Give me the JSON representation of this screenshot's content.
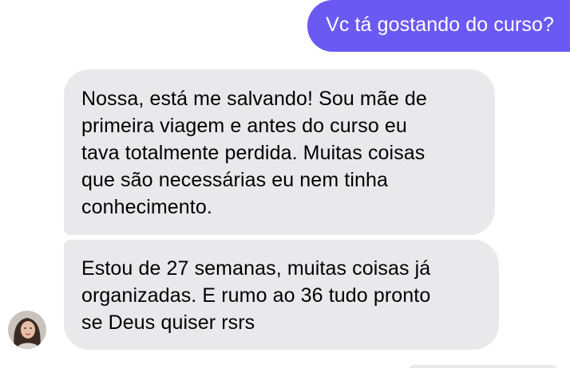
{
  "messages": {
    "sent": {
      "text": "Vc tá gostando do curso?"
    },
    "received": [
      {
        "lines": [
          "Nossa, está me salvando! Sou mãe de",
          "primeira viagem e antes do curso eu",
          "tava totalmente perdida. Muitas coisas",
          "que são necessárias eu nem tinha",
          "conhecimento."
        ]
      },
      {
        "lines": [
          "Estou de 27 semanas, muitas coisas já",
          "organizadas. E rumo ao 36 tudo pronto",
          "se Deus quiser rsrs"
        ]
      }
    ]
  },
  "colors": {
    "sent_bubble": "#6b59f3",
    "received_bubble": "#e9e9eb",
    "background": "#ffffff"
  },
  "icons": {
    "avatar": "contact-avatar-photo"
  }
}
